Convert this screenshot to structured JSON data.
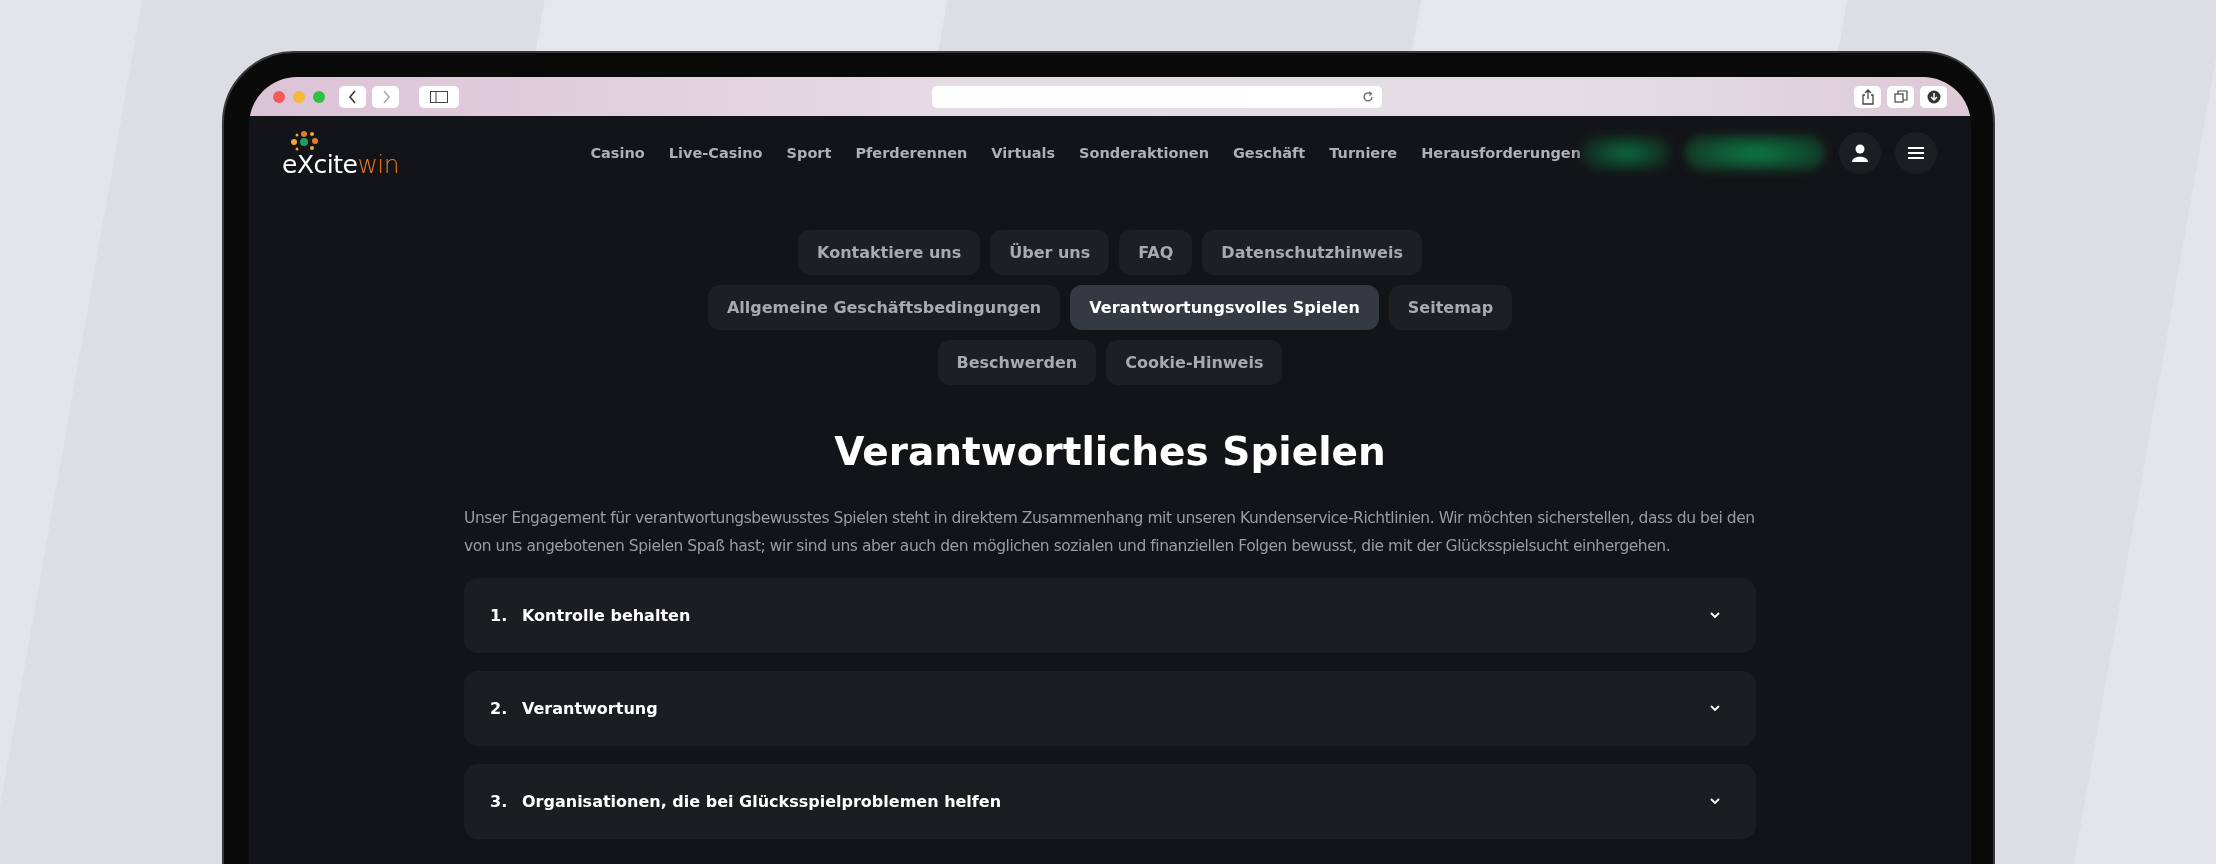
{
  "site": {
    "logo": {
      "first": "eXcite",
      "second": "win"
    }
  },
  "nav": [
    "Casino",
    "Live-Casino",
    "Sport",
    "Pferderennen",
    "Virtuals",
    "Sonderaktionen",
    "Geschäft",
    "Turniere",
    "Herausforderungen"
  ],
  "tab_rows": [
    [
      {
        "label": "Kontaktiere uns",
        "selected": false
      },
      {
        "label": "Über uns",
        "selected": false
      },
      {
        "label": "FAQ",
        "selected": false
      },
      {
        "label": "Datenschutzhinweis",
        "selected": false
      }
    ],
    [
      {
        "label": "Allgemeine Geschäftsbedingungen",
        "selected": false
      },
      {
        "label": "Verantwortungsvolles Spielen",
        "selected": true
      },
      {
        "label": "Seitemap",
        "selected": false
      }
    ],
    [
      {
        "label": "Beschwerden",
        "selected": false
      },
      {
        "label": "Cookie-Hinweis",
        "selected": false
      }
    ]
  ],
  "title": "Verantwortliches Spielen",
  "intro": "Unser Engagement für verantwortungsbewusstes Spielen steht in direktem Zusammenhang mit unseren Kundenservice-Richtlinien. Wir möchten sicherstellen, dass du bei den von uns angebotenen Spielen Spaß hast; wir sind uns aber auch den möglichen sozialen und finanziellen Folgen bewusst, die mit der Glücksspielsucht einhergehen.",
  "sections": [
    {
      "number": "1.",
      "title": "Kontrolle behalten",
      "expanded": false
    },
    {
      "number": "2.",
      "title": "Verantwortung",
      "expanded": false
    },
    {
      "number": "3.",
      "title": "Organisationen, die bei Glücksspielproblemen helfen",
      "expanded": false
    }
  ]
}
